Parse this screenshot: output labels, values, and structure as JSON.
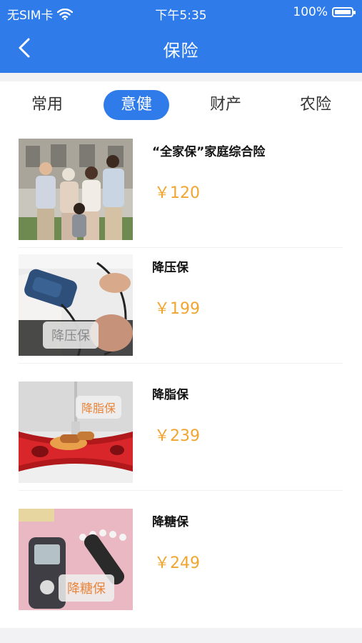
{
  "status_bar": {
    "carrier": "无SIM卡",
    "time": "下午5:35",
    "battery": "100%"
  },
  "nav": {
    "title": "保险"
  },
  "tabs": [
    {
      "label": "常用",
      "active": false
    },
    {
      "label": "意健",
      "active": true
    },
    {
      "label": "财产",
      "active": false
    },
    {
      "label": "农险",
      "active": false
    }
  ],
  "items": [
    {
      "title": "“全家保”家庭综合险",
      "price": "￥120",
      "image": "family-photo",
      "overlay": ""
    },
    {
      "title": "降压保",
      "price": "￥199",
      "image": "blood-pressure-photo",
      "overlay": "降压保"
    },
    {
      "title": "降脂保",
      "price": "￥239",
      "image": "artery-fat-photo",
      "overlay": "降脂保"
    },
    {
      "title": "降糖保",
      "price": "￥249",
      "image": "glucose-meter-photo",
      "overlay": "降糖保"
    }
  ],
  "colors": {
    "brand": "#2f7bea",
    "price": "#f0a530",
    "overlay_text": "#e9853a"
  }
}
